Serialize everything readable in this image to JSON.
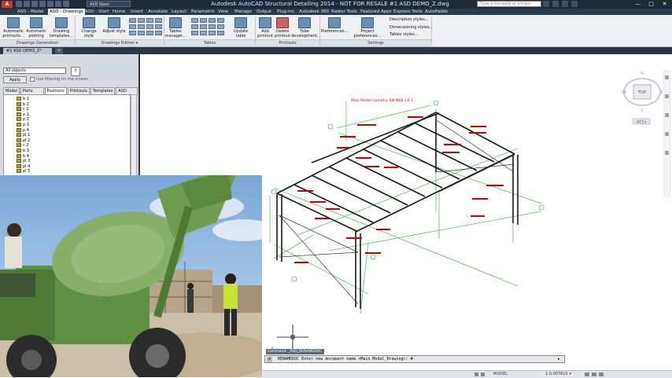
{
  "window": {
    "title": "Autodesk AutoCAD Structural Detailing 2014 - NOT FOR RESALE    #1 ASD DEMO_Z.dwg",
    "logo": "A",
    "workspace": "ASD Steel",
    "search_placeholder": "Type a keyword or phrase",
    "controls": [
      "—",
      "□",
      "✕"
    ]
  },
  "ribbon_tabs": [
    {
      "label": "ASD - Model"
    },
    {
      "label": "ASD - Drawings"
    },
    {
      "label": "ASD - Start"
    },
    {
      "label": "Home"
    },
    {
      "label": "Insert"
    },
    {
      "label": "Annotate"
    },
    {
      "label": "Layout"
    },
    {
      "label": "Parametric"
    },
    {
      "label": "View"
    },
    {
      "label": "Manage"
    },
    {
      "label": "Output"
    },
    {
      "label": "Plug-ins"
    },
    {
      "label": "Autodesk 360"
    },
    {
      "label": "Raster Tools"
    },
    {
      "label": "Featured Apps"
    },
    {
      "label": "Express Tools"
    },
    {
      "label": "AutoPadds"
    }
  ],
  "ribbon": {
    "buttons": {
      "automatic_printouts": "Automatic printouts...",
      "automatic_plotting": "Automatic plotting",
      "drawing_templates": "Drawing templates...",
      "change_style": "Change style",
      "adjust_style": "Adjust style",
      "tables_manager": "Tables manager...",
      "update_table": "Update table",
      "add_printout": "Add printout",
      "delete_printout": "Delete printout",
      "tube_development": "Tube development...",
      "preferences": "Preferences...",
      "project_preferences": "Project preferences...",
      "description_styles": "Description styles...",
      "dimensioning_styles": "Dimensioning styles...",
      "tables_styles": "Tables styles..."
    },
    "panels": {
      "drawings_generation": "Drawings Generation",
      "drawings_edition": "Drawings Edition ▾",
      "tables": "Tables",
      "printouts": "Printouts",
      "settings": "Settings"
    }
  },
  "document_tabs": {
    "active": "#1 ASD DEMO_Z*",
    "add": "+"
  },
  "left_panel": {
    "filter_value": "All objects",
    "help": "?",
    "apply": "Apply",
    "use_filtering_label": "Use filtering on the screen",
    "tabs": [
      "Model",
      "Parts Edition",
      "Positions",
      "Printouts",
      "Templates",
      "ASD Center"
    ],
    "active_tab": "Positions",
    "tree_items": [
      "b 1",
      "b 2",
      "c 1",
      "p 1",
      "p 2",
      "p 3",
      "p 4",
      "pl 1",
      "pl 2",
      "c 2",
      "b 3",
      "b 4",
      "pl 3",
      "pl 4",
      "pl 5"
    ]
  },
  "drawing": {
    "title_label": "Main Model Isometry  SW  NE8 1.6 1",
    "primary_color": "#cc0000",
    "grid_color": "#20b020",
    "steel_color": "#1a1a1a"
  },
  "viewcube": {
    "top": "TOP",
    "north": "N",
    "south": "S",
    "east": "E",
    "west": "W",
    "wcs": "WCS ▾"
  },
  "command": {
    "history": "Command: _ASD_RENAMEDOC",
    "prompt": "RENAMEDOC Enter new document name <Main Model_Drawing>: #",
    "close": "×",
    "arrow": "▸"
  },
  "status": {
    "model": "MODEL",
    "scale": "1:0.007815 ▾"
  },
  "colors": {
    "title_bar": "#1d2a3a",
    "ribbon_bg": "#eef0f2",
    "canvas_bg": "#ffffff"
  }
}
